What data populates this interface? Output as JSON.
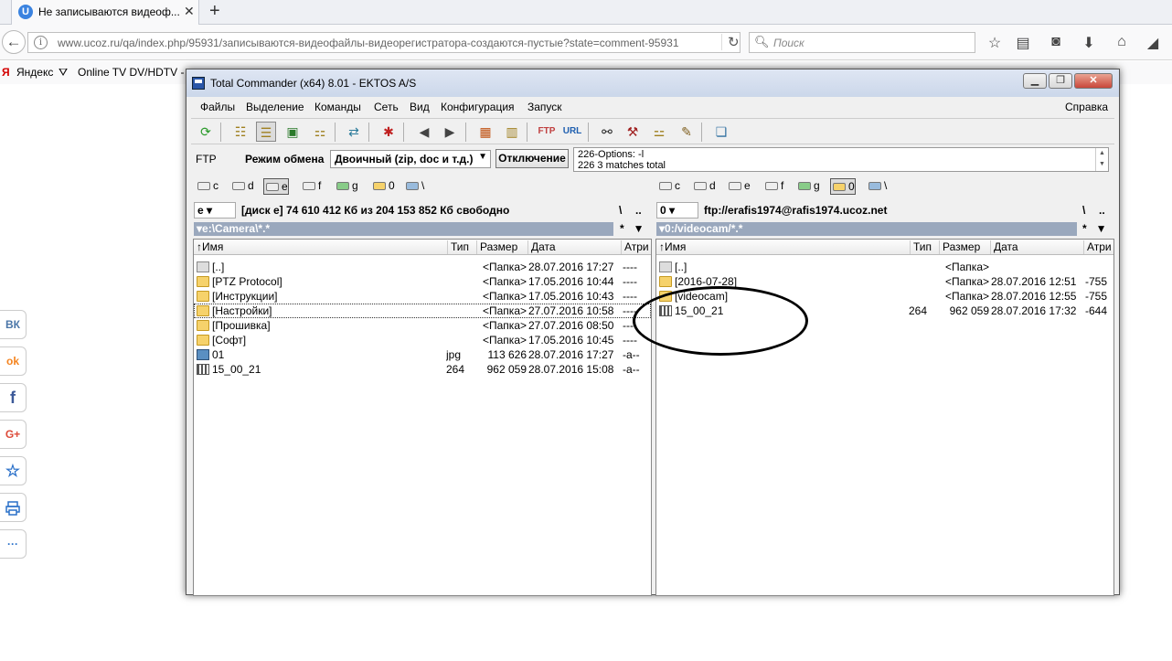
{
  "browser": {
    "tab_title": "Не записываются видеоф...",
    "tab_favicon": "U",
    "url_domain": "www.ucoz.ru",
    "url_path": "/qa/index.php/95931/записываются-видеофайлы-видеорегистратора-создаются-пустые?state=comment-95931",
    "search_placeholder": "Поиск",
    "bookmarks": [
      "Яндекс",
      "Online TV DV/HDTV -"
    ]
  },
  "share_bar": [
    "ВК",
    "ok",
    "f",
    "G+",
    "☆",
    "print",
    "···"
  ],
  "tc": {
    "title": "Total Commander (x64) 8.01 - EKTOS A/S",
    "menu": [
      "Файлы",
      "Выделение",
      "Команды",
      "Сеть",
      "Вид",
      "Конфигурация",
      "Запуск"
    ],
    "menu_help": "Справка",
    "ftp": {
      "label": "FTP",
      "mode_label": "Режим обмена",
      "mode_value": "Двоичный (zip, doc и т.д.)",
      "disconnect": "Отключение",
      "log_line1": "226-Options: -l",
      "log_line2": "226 3 matches total"
    },
    "left": {
      "drives": [
        "c",
        "d",
        "e",
        "f",
        "g",
        "0",
        "\\"
      ],
      "active_drive": "e",
      "drive_select": "e",
      "drive_info": "[диск e]  74 610 412 Кб из 204 153 852 Кб свободно",
      "path": "e:\\Camera\\*.*",
      "path_ctl1": "\\",
      "path_ctl2": "..",
      "filter": "*",
      "columns": [
        "Имя",
        "Тип",
        "Размер",
        "Дата",
        "Атри"
      ],
      "rows": [
        {
          "icon": "up",
          "name": "[..]",
          "type": "",
          "size": "<Папка>",
          "date": "28.07.2016 17:27",
          "attr": "----"
        },
        {
          "icon": "folder",
          "name": "[PTZ Protocol]",
          "type": "",
          "size": "<Папка>",
          "date": "17.05.2016 10:44",
          "attr": "----"
        },
        {
          "icon": "folder",
          "name": "[Инструкции]",
          "type": "",
          "size": "<Папка>",
          "date": "17.05.2016 10:43",
          "attr": "----"
        },
        {
          "icon": "folder",
          "name": "[Настройки]",
          "type": "",
          "size": "<Папка>",
          "date": "27.07.2016 10:58",
          "attr": "----"
        },
        {
          "icon": "folder",
          "name": "[Прошивка]",
          "type": "",
          "size": "<Папка>",
          "date": "27.07.2016 08:50",
          "attr": "----"
        },
        {
          "icon": "folder",
          "name": "[Софт]",
          "type": "",
          "size": "<Папка>",
          "date": "17.05.2016 10:45",
          "attr": "----"
        },
        {
          "icon": "img",
          "name": "01",
          "type": "jpg",
          "size": "113 626",
          "date": "28.07.2016 17:27",
          "attr": "-a--"
        },
        {
          "icon": "vid",
          "name": "15_00_21",
          "type": "264",
          "size": "962 059",
          "date": "28.07.2016 15:08",
          "attr": "-a--"
        }
      ]
    },
    "right": {
      "drives": [
        "c",
        "d",
        "e",
        "f",
        "g",
        "0",
        "\\"
      ],
      "active_drive": "0",
      "drive_select": "0",
      "drive_info": "ftp://erafis1974@rafis1974.ucoz.net",
      "path": "0:/videocam/*.*",
      "path_ctl1": "\\",
      "path_ctl2": "..",
      "filter": "*",
      "columns": [
        "Имя",
        "Тип",
        "Размер",
        "Дата",
        "Атри"
      ],
      "rows": [
        {
          "icon": "up",
          "name": "[..]",
          "type": "",
          "size": "<Папка>",
          "date": "",
          "attr": ""
        },
        {
          "icon": "folder",
          "name": "[2016-07-28]",
          "type": "",
          "size": "<Папка>",
          "date": "28.07.2016 12:51",
          "attr": "-755"
        },
        {
          "icon": "folder",
          "name": "[videocam]",
          "type": "",
          "size": "<Папка>",
          "date": "28.07.2016 12:55",
          "attr": "-755"
        },
        {
          "icon": "vid",
          "name": "15_00_21",
          "type": "264",
          "size": "962 059",
          "date": "28.07.2016 17:32",
          "attr": "-644"
        }
      ]
    }
  }
}
